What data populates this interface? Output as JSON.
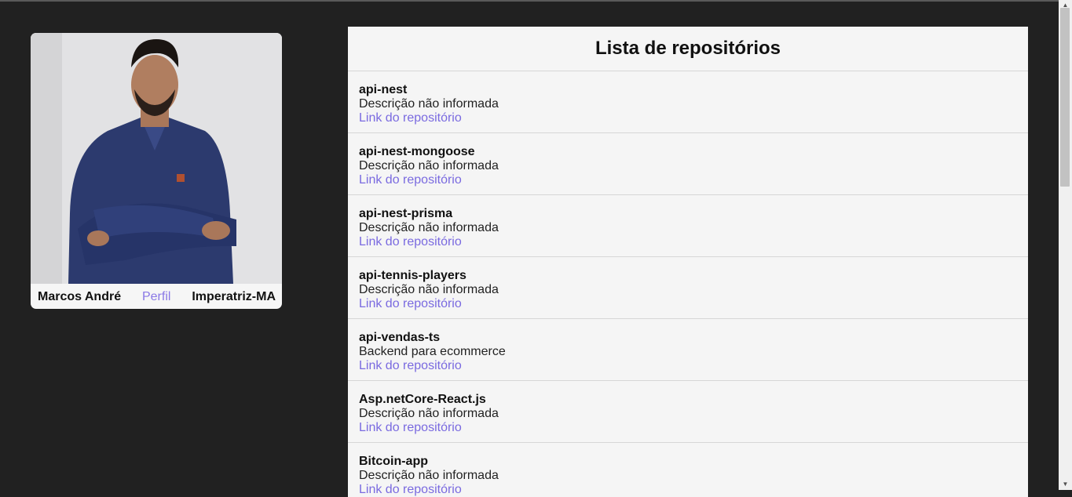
{
  "profile": {
    "name": "Marcos André",
    "profile_link": "Perfil",
    "location": "Imperatriz-MA"
  },
  "repos": {
    "title": "Lista de repositórios",
    "items": [
      {
        "name": "api-nest",
        "description": "Descrição não informada",
        "link": "Link do repositório"
      },
      {
        "name": "api-nest-mongoose",
        "description": "Descrição não informada",
        "link": "Link do repositório"
      },
      {
        "name": "api-nest-prisma",
        "description": "Descrição não informada",
        "link": "Link do repositório"
      },
      {
        "name": "api-tennis-players",
        "description": "Descrição não informada",
        "link": "Link do repositório"
      },
      {
        "name": "api-vendas-ts",
        "description": "Backend para ecommerce",
        "link": "Link do repositório"
      },
      {
        "name": "Asp.netCore-React.js",
        "description": "Descrição não informada",
        "link": "Link do repositório"
      },
      {
        "name": "Bitcoin-app",
        "description": "Descrição não informada",
        "link": "Link do repositório"
      }
    ]
  },
  "colors": {
    "background": "#212121",
    "card": "#f5f5f5",
    "link": "#7a6ae0"
  }
}
